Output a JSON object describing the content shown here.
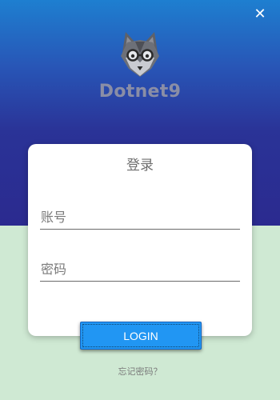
{
  "window": {
    "close_symbol": "✕"
  },
  "brand": {
    "name": "Dotnet9",
    "logo_icon": "wolf-with-glasses-icon"
  },
  "login_card": {
    "title": "登录",
    "account_placeholder": "账号",
    "password_placeholder": "密码"
  },
  "login_button": {
    "label": "LOGIN"
  },
  "forgot_link": {
    "label": "忘记密码？"
  },
  "colors": {
    "header_gradient_top": "#1e7fd0",
    "header_gradient_bottom": "#2b2a8f",
    "background_bottom": "#cfe9d3",
    "button": "#2196f3",
    "card": "#ffffff"
  }
}
